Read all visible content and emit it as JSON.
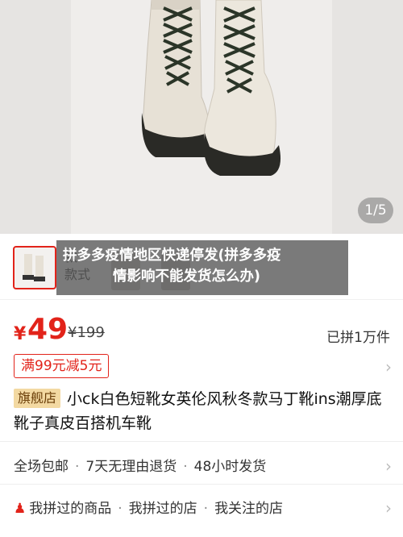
{
  "gallery": {
    "page_indicator": "1/5"
  },
  "variant": {
    "label": "款式",
    "label_prefix": "款"
  },
  "overlay": {
    "line1": "拼多多疫情地区快递停发(拼多多疫",
    "line2": "情影响不能发货怎么办)"
  },
  "price": {
    "currency": "¥",
    "value": "49",
    "original": "¥199",
    "sold": "已拼1万件"
  },
  "coupon": {
    "label": "满99元减5元"
  },
  "product": {
    "store_badge": "旗舰店",
    "title": "小ck白色短靴女英伦风秋冬款马丁靴ins潮厚底靴子真皮百搭机车靴"
  },
  "service": {
    "item1": "全场包邮",
    "item2": "7天无理由退货",
    "item3": "48小时发货"
  },
  "history": {
    "item1": "我拼过的商品",
    "item2": "我拼过的店",
    "item3": "我关注的店"
  },
  "colors": {
    "accent": "#e2231a",
    "badge_bg": "#f3d9a2"
  }
}
